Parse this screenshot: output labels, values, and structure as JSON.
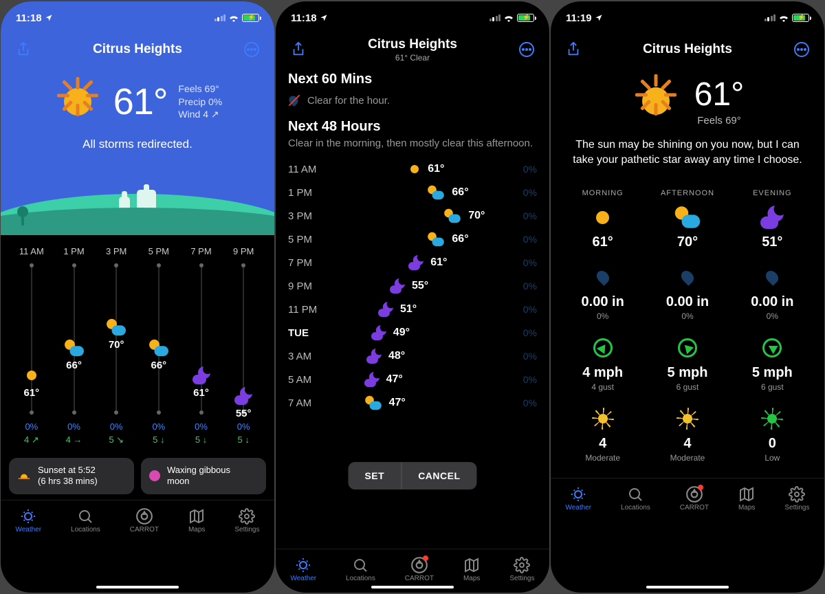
{
  "status": {
    "time_a": "11:18",
    "time_b": "11:18",
    "time_c": "11:19"
  },
  "tabs": {
    "weather": "Weather",
    "locations": "Locations",
    "carrot": "CARROT",
    "maps": "Maps",
    "settings": "Settings"
  },
  "s1": {
    "title": "Citrus Heights",
    "temp": "61°",
    "feels": "Feels 69°",
    "precip": "Precip 0%",
    "wind": "Wind 4 ↗",
    "tagline": "All storms redirected.",
    "hours": [
      "11 AM",
      "1 PM",
      "3 PM",
      "5 PM",
      "7 PM",
      "9 PM"
    ],
    "hour_temps": [
      "61°",
      "66°",
      "70°",
      "66°",
      "61°",
      "55°"
    ],
    "hour_icons": [
      "sun",
      "partly",
      "partly",
      "partly",
      "moon",
      "moon"
    ],
    "hour_pos": [
      150,
      110,
      80,
      110,
      150,
      180
    ],
    "hour_precip": [
      "0%",
      "0%",
      "0%",
      "0%",
      "0%",
      "0%"
    ],
    "hour_wind": [
      "4 ↗",
      "4 →",
      "5 ↘",
      "5 ↓",
      "5 ↓",
      "5 ↓"
    ],
    "sunset_line1": "Sunset at 5:52",
    "sunset_line2": "(6 hrs 38 mins)",
    "moon_line1": "Waxing gibbous",
    "moon_line2": "moon"
  },
  "s2": {
    "title": "Citrus Heights",
    "subtitle": "61° Clear",
    "sec60_title": "Next 60 Mins",
    "sec60_sub": "Clear for the hour.",
    "sec48_title": "Next 48 Hours",
    "sec48_sub": "Clear in the morning, then mostly clear this afternoon.",
    "rows": [
      {
        "t": "11 AM",
        "temp": "61°",
        "icon": "sun",
        "pos": 0.56,
        "day": false
      },
      {
        "t": "1 PM",
        "temp": "66°",
        "icon": "partly",
        "pos": 0.72,
        "day": false
      },
      {
        "t": "3 PM",
        "temp": "70°",
        "icon": "partly",
        "pos": 0.86,
        "day": false
      },
      {
        "t": "5 PM",
        "temp": "66°",
        "icon": "partly",
        "pos": 0.72,
        "day": false
      },
      {
        "t": "7 PM",
        "temp": "61°",
        "icon": "moon",
        "pos": 0.56,
        "day": false
      },
      {
        "t": "9 PM",
        "temp": "55°",
        "icon": "moon",
        "pos": 0.4,
        "day": false
      },
      {
        "t": "11 PM",
        "temp": "51°",
        "icon": "moon",
        "pos": 0.3,
        "day": false
      },
      {
        "t": "TUE",
        "temp": "49°",
        "icon": "moon",
        "pos": 0.24,
        "day": true
      },
      {
        "t": "3 AM",
        "temp": "48°",
        "icon": "moon",
        "pos": 0.2,
        "day": false
      },
      {
        "t": "5 AM",
        "temp": "47°",
        "icon": "moon",
        "pos": 0.18,
        "day": false
      },
      {
        "t": "7 AM",
        "temp": "47°",
        "icon": "partly",
        "pos": 0.18,
        "day": false
      }
    ],
    "precip_col": "0%",
    "set": "SET",
    "cancel": "CANCEL"
  },
  "s3": {
    "title": "Citrus Heights",
    "temp": "61°",
    "feels": "Feels 69°",
    "snark": "The sun may be shining on you now, but I can take your pathetic star away any time I choose.",
    "parts": [
      "MORNING",
      "AFTERNOON",
      "EVENING"
    ],
    "cond_icon": [
      "sun",
      "partly",
      "moon"
    ],
    "cond_temp": [
      "61°",
      "70°",
      "51°"
    ],
    "precip_amt": [
      "0.00 in",
      "0.00 in",
      "0.00 in"
    ],
    "precip_pct": [
      "0%",
      "0%",
      "0%"
    ],
    "wind_spd": [
      "4 mph",
      "5 mph",
      "5 mph"
    ],
    "wind_gust": [
      "4 gust",
      "6 gust",
      "6 gust"
    ],
    "wind_dir": [
      35,
      -45,
      -60
    ],
    "uv_val": [
      "4",
      "4",
      "0"
    ],
    "uv_lbl": [
      "Moderate",
      "Moderate",
      "Low"
    ],
    "uv_col": [
      "y",
      "y",
      "g"
    ]
  }
}
